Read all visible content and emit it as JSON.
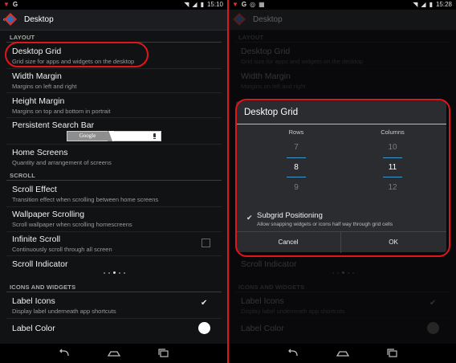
{
  "left": {
    "status_time": "15:10",
    "title": "Desktop",
    "sections": {
      "layout": "LAYOUT",
      "scroll": "SCROLL",
      "icons": "ICONS AND WIDGETS"
    },
    "items": [
      {
        "title": "Desktop Grid",
        "sub": "Grid size for apps and widgets on the desktop"
      },
      {
        "title": "Width Margin",
        "sub": "Margins on left and right"
      },
      {
        "title": "Height Margin",
        "sub": "Margins on top and bottom in portrait"
      },
      {
        "title": "Persistent Search Bar",
        "sub": ""
      },
      {
        "title": "Home Screens",
        "sub": "Quantity and arrangement of screens"
      },
      {
        "title": "Scroll Effect",
        "sub": "Transition effect when scrolling between home screens"
      },
      {
        "title": "Wallpaper Scrolling",
        "sub": "Scroll wallpaper when scrolling homescreens"
      },
      {
        "title": "Infinite Scroll",
        "sub": "Continuously scroll through all screen"
      },
      {
        "title": "Scroll Indicator",
        "sub": ""
      },
      {
        "title": "Label Icons",
        "sub": "Display label underneath app shortcuts"
      },
      {
        "title": "Label Color",
        "sub": ""
      }
    ],
    "search_google": "Google",
    "colors": {
      "label_color": "#ffffff",
      "highlight": "#e3151a"
    }
  },
  "right": {
    "status_time": "15:28",
    "title": "Desktop",
    "sections": {
      "layout": "LAYOUT",
      "icons": "ICONS AND WIDGETS"
    },
    "items": [
      {
        "title": "Desktop Grid",
        "sub": "Grid size for apps and widgets on the desktop"
      },
      {
        "title": "Width Margin",
        "sub": "Margins on left and right"
      },
      {
        "title": "Scroll Indicator",
        "sub": ""
      },
      {
        "title": "Label Icons",
        "sub": "Display label underneath app shortcuts"
      },
      {
        "title": "Label Color",
        "sub": ""
      }
    ],
    "dialog": {
      "title": "Desktop Grid",
      "rows_label": "Rows",
      "columns_label": "Columns",
      "rows": {
        "prev": "7",
        "value": "8",
        "next": "9"
      },
      "columns": {
        "prev": "10",
        "value": "11",
        "next": "12"
      },
      "subgrid_title": "Subgrid Positioning",
      "subgrid_sub": "Allow snapping widgets or icons half way through grid cells",
      "cancel": "Cancel",
      "ok": "OK"
    },
    "colors": {
      "label_color": "#b0b0b0",
      "accent": "#3f97c9"
    }
  }
}
